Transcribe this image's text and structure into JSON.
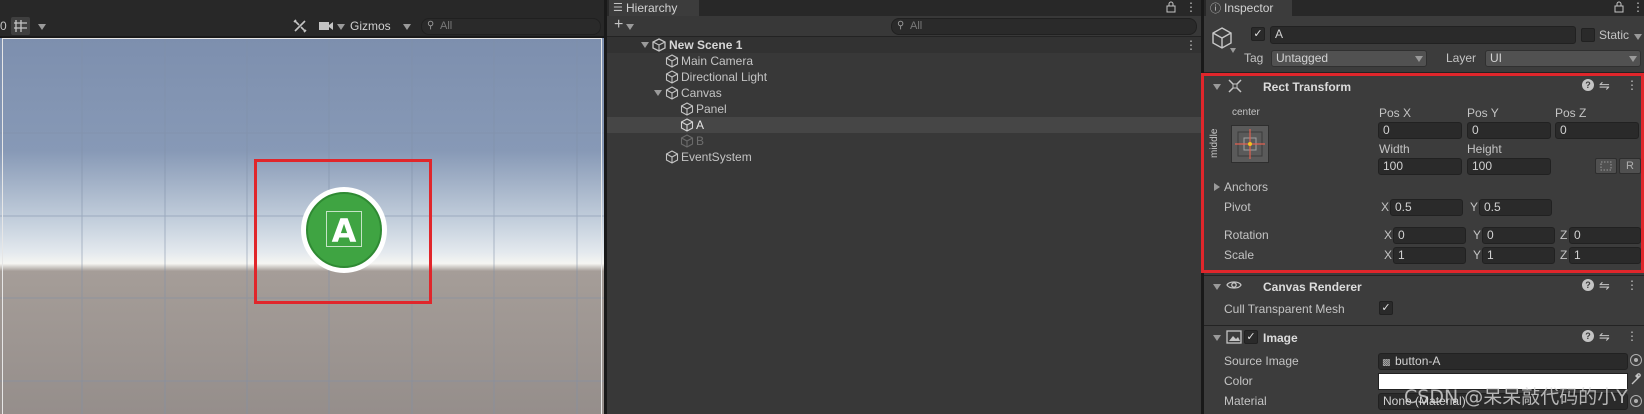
{
  "scene": {
    "toolbar": {
      "gizmos_label": "Gizmos",
      "search_placeholder": "All",
      "left_text": "0"
    },
    "button_letter": "A"
  },
  "hierarchy": {
    "tab_label": "Hierarchy",
    "search_placeholder": "All",
    "scene_name": "New Scene 1",
    "items": [
      {
        "label": "Main Camera",
        "indent": 1
      },
      {
        "label": "Directional Light",
        "indent": 1
      },
      {
        "label": "Canvas",
        "indent": 1
      },
      {
        "label": "Panel",
        "indent": 2
      },
      {
        "label": "A",
        "indent": 2
      },
      {
        "label": "B",
        "indent": 2
      },
      {
        "label": "EventSystem",
        "indent": 1
      }
    ]
  },
  "inspector": {
    "tab_label": "Inspector",
    "object_name": "A",
    "static_label": "Static",
    "tag_label": "Tag",
    "tag_value": "Untagged",
    "layer_label": "Layer",
    "layer_value": "UI",
    "rect_transform": {
      "title": "Rect Transform",
      "anchor_h": "center",
      "anchor_v": "middle",
      "pos_x_label": "Pos X",
      "pos_y_label": "Pos Y",
      "pos_z_label": "Pos Z",
      "pos_x": "0",
      "pos_y": "0",
      "pos_z": "0",
      "width_label": "Width",
      "height_label": "Height",
      "width": "100",
      "height": "100",
      "r_button": "R",
      "anchors_label": "Anchors",
      "pivot_label": "Pivot",
      "pivot_x": "0.5",
      "pivot_y": "0.5",
      "rotation_label": "Rotation",
      "rot_x": "0",
      "rot_y": "0",
      "rot_z": "0",
      "scale_label": "Scale",
      "scale_x": "1",
      "scale_y": "1",
      "scale_z": "1",
      "x_label": "X",
      "y_label": "Y",
      "z_label": "Z"
    },
    "canvas_renderer": {
      "title": "Canvas Renderer",
      "cull_label": "Cull Transparent Mesh",
      "cull_checked": "✓"
    },
    "image": {
      "title": "Image",
      "source_label": "Source Image",
      "source_value": "button-A",
      "color_label": "Color",
      "material_label": "Material",
      "material_value": "None (Material)"
    },
    "check_mark": "✓"
  },
  "watermark": "CSDN @呆呆敲代码的小Y",
  "colors": {
    "highlight_red": "#e0262b",
    "button_green": "#3fa442",
    "panel_bg": "#383838",
    "selected_row": "#464646"
  }
}
